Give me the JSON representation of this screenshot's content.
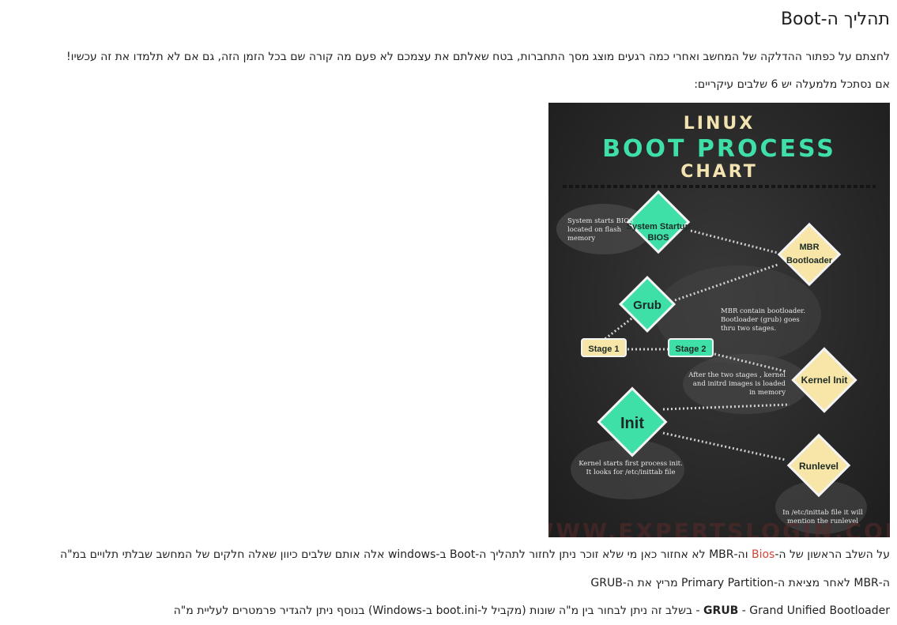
{
  "article": {
    "title": "תהליך ה-Boot",
    "intro": "לחצתם על כפתור ההדלקה של המחשב ואחרי כמה רגעים מוצג מסך התחברות, בטח שאלתם את עצמכם לא פעם מה קורה שם בכל הזמן הזה, גם אם לא תלמדו את זה עכשיו!",
    "steps_intro": "אם נסתכל מלמעלה יש 6 שלבים עיקריים:",
    "p3_before": "על השלב הראשון של ה-",
    "p3_link": "Bios",
    "p3_after": " וה-MBR לא אחזור כאן מי שלא זוכר ניתן לחזור לתהליך ה-Boot ב-windows אלה אותם שלבים כיוון שאלה חלקים של המחשב שבלתי תלויים במ\"ה",
    "p4": "ה-MBR לאחר מציאת ה-Primary Partition מריץ את ה-GRUB",
    "p5_bold": "GRUB",
    "p5_rest": " - Grand Unified Bootloader - בשלב זה ניתן לבחור בין מ\"ה שונות (מקביל ל-boot.ini ב-Windows) בנוסף ניתן להגדיר פרמטרים לעליית מ\"ה"
  },
  "infographic": {
    "title_line1": "LINUX",
    "title_line2": "BOOT PROCESS",
    "title_line3": "CHART",
    "nodes": {
      "system_startup": [
        "System Startup",
        "BIOS"
      ],
      "mbr": [
        "MBR",
        "Bootloader"
      ],
      "grub": "Grub",
      "stage1": "Stage 1",
      "stage2": "Stage 2",
      "kernel": "Kernel Init",
      "init": "Init",
      "runlevel": "Runlevel"
    },
    "notes": {
      "bios": [
        "System starts BIOS",
        "located on flash",
        "memory"
      ],
      "mbr": [
        "MBR contain bootloader.",
        "Bootloader (grub) goes",
        "thru two stages."
      ],
      "kernel": [
        "After the two stages , kernel",
        "and initrd images is loaded",
        "in memory"
      ],
      "init": [
        "Kernel starts first process init.",
        "It looks for /etc/inittab file"
      ],
      "runlevel": [
        "In /etc/inittab file it will",
        "mention the runlevel"
      ]
    },
    "watermark": "WWW.EXPERTSLOGIN.COM",
    "colors": {
      "teal": "#3fe0a8",
      "cream": "#f7e6a8",
      "background": "#2b2a2a",
      "title_cream": "#f3e3b0"
    }
  }
}
